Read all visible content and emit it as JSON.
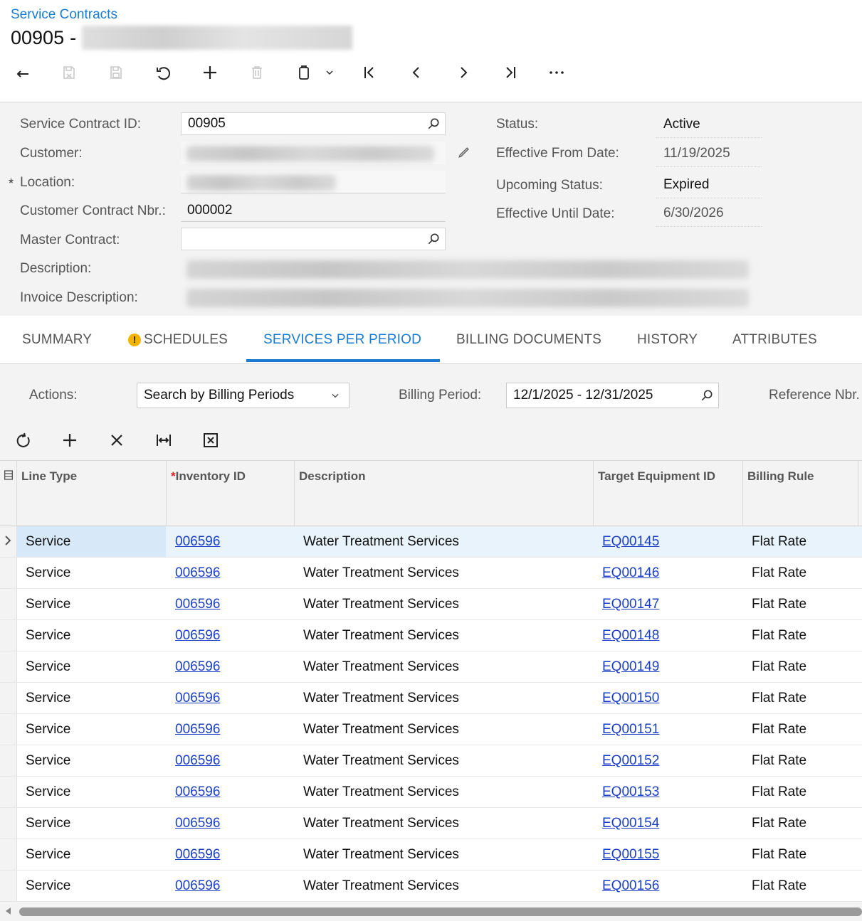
{
  "breadcrumb": "Service Contracts",
  "title": {
    "id": "00905",
    "separator": "-"
  },
  "toolbar": {
    "icons": [
      "back-icon",
      "discard-save-icon",
      "save-icon",
      "undo-icon",
      "add-icon",
      "delete-icon",
      "copy-paste-icon",
      "chevron-down-icon",
      "first-record-icon",
      "previous-record-icon",
      "next-record-icon",
      "last-record-icon",
      "more-icon"
    ]
  },
  "form": {
    "labels": {
      "service_contract_id": "Service Contract ID:",
      "customer": "Customer:",
      "location": "Location:",
      "customer_contract_nbr": "Customer Contract Nbr.:",
      "master_contract": "Master Contract:",
      "description": "Description:",
      "invoice_description": "Invoice Description:",
      "status": "Status:",
      "effective_from_date": "Effective From Date:",
      "upcoming_status": "Upcoming Status:",
      "effective_until_date": "Effective Until Date:"
    },
    "required_marker": "*",
    "values": {
      "service_contract_id": "00905",
      "customer_contract_nbr": "000002",
      "master_contract": "",
      "status": "Active",
      "effective_from_date": "11/19/2025",
      "upcoming_status": "Expired",
      "effective_until_date": "6/30/2026"
    }
  },
  "tabs": [
    {
      "label": "SUMMARY"
    },
    {
      "label": "SCHEDULES",
      "warning": "!"
    },
    {
      "label": "SERVICES PER PERIOD",
      "active": true
    },
    {
      "label": "BILLING DOCUMENTS"
    },
    {
      "label": "HISTORY"
    },
    {
      "label": "ATTRIBUTES"
    }
  ],
  "filters": {
    "actions_label": "Actions:",
    "actions_value": "Search by Billing Periods",
    "billing_period_label": "Billing Period:",
    "billing_period_value": "12/1/2025 - 12/31/2025",
    "reference_nbr_label": "Reference Nbr."
  },
  "grid_toolbar": [
    "refresh-icon",
    "add-row-icon",
    "delete-row-icon",
    "fit-columns-icon",
    "export-excel-icon"
  ],
  "table": {
    "columns": [
      {
        "label": "Line Type"
      },
      {
        "label": "Inventory ID",
        "required": "*"
      },
      {
        "label": "Description"
      },
      {
        "label": "Target Equipment ID"
      },
      {
        "label": "Billing Rule"
      }
    ],
    "rows": [
      {
        "line_type": "Service",
        "inventory_id": "006596",
        "description": "Water Treatment Services",
        "equipment_id": "EQ00145",
        "billing_rule": "Flat Rate"
      },
      {
        "line_type": "Service",
        "inventory_id": "006596",
        "description": "Water Treatment Services",
        "equipment_id": "EQ00146",
        "billing_rule": "Flat Rate"
      },
      {
        "line_type": "Service",
        "inventory_id": "006596",
        "description": "Water Treatment Services",
        "equipment_id": "EQ00147",
        "billing_rule": "Flat Rate"
      },
      {
        "line_type": "Service",
        "inventory_id": "006596",
        "description": "Water Treatment Services",
        "equipment_id": "EQ00148",
        "billing_rule": "Flat Rate"
      },
      {
        "line_type": "Service",
        "inventory_id": "006596",
        "description": "Water Treatment Services",
        "equipment_id": "EQ00149",
        "billing_rule": "Flat Rate"
      },
      {
        "line_type": "Service",
        "inventory_id": "006596",
        "description": "Water Treatment Services",
        "equipment_id": "EQ00150",
        "billing_rule": "Flat Rate"
      },
      {
        "line_type": "Service",
        "inventory_id": "006596",
        "description": "Water Treatment Services",
        "equipment_id": "EQ00151",
        "billing_rule": "Flat Rate"
      },
      {
        "line_type": "Service",
        "inventory_id": "006596",
        "description": "Water Treatment Services",
        "equipment_id": "EQ00152",
        "billing_rule": "Flat Rate"
      },
      {
        "line_type": "Service",
        "inventory_id": "006596",
        "description": "Water Treatment Services",
        "equipment_id": "EQ00153",
        "billing_rule": "Flat Rate"
      },
      {
        "line_type": "Service",
        "inventory_id": "006596",
        "description": "Water Treatment Services",
        "equipment_id": "EQ00154",
        "billing_rule": "Flat Rate"
      },
      {
        "line_type": "Service",
        "inventory_id": "006596",
        "description": "Water Treatment Services",
        "equipment_id": "EQ00155",
        "billing_rule": "Flat Rate"
      },
      {
        "line_type": "Service",
        "inventory_id": "006596",
        "description": "Water Treatment Services",
        "equipment_id": "EQ00156",
        "billing_rule": "Flat Rate"
      }
    ]
  },
  "colors": {
    "accent": "#1a7bd1",
    "link": "#1a3fc4",
    "selected_row": "#e8f3fc",
    "warning": "#f3b400"
  }
}
